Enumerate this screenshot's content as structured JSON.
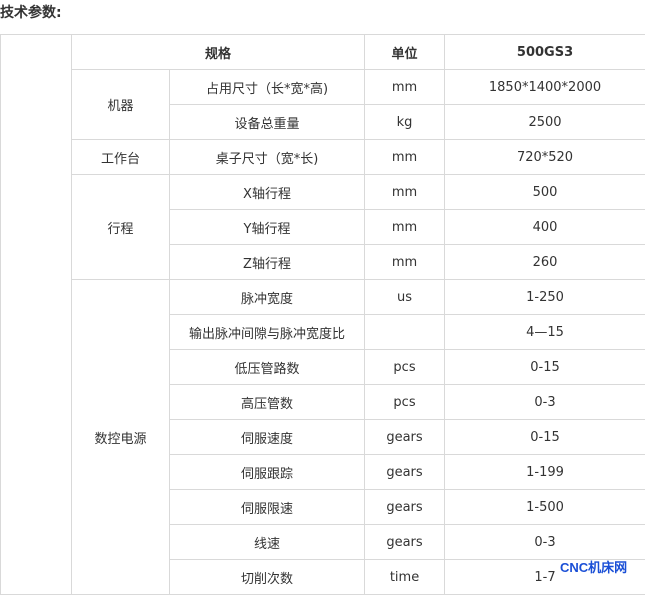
{
  "heading": "技术参数:",
  "columns": {
    "spec": "规格",
    "unit": "单位",
    "model": "500GS3"
  },
  "groups": {
    "machine": "机器",
    "worktable": "工作台",
    "travel": "行程",
    "power": "数控电源"
  },
  "rows": [
    {
      "name": "占用尺寸（长*宽*高)",
      "unit": "mm",
      "value": "1850*1400*2000"
    },
    {
      "name": "设备总重量",
      "unit": "kg",
      "value": "2500"
    },
    {
      "name": "桌子尺寸（宽*长)",
      "unit": "mm",
      "value": "720*520"
    },
    {
      "name": "X轴行程",
      "unit": "mm",
      "value": "500"
    },
    {
      "name": "Y轴行程",
      "unit": "mm",
      "value": "400"
    },
    {
      "name": "Z轴行程",
      "unit": "mm",
      "value": "260"
    },
    {
      "name": "脉冲宽度",
      "unit": "us",
      "value": "1-250"
    },
    {
      "name": "输出脉冲间隙与脉冲宽度比",
      "unit": "",
      "value": "4—15"
    },
    {
      "name": "低压管路数",
      "unit": "pcs",
      "value": "0-15"
    },
    {
      "name": "高压管数",
      "unit": "pcs",
      "value": "0-3"
    },
    {
      "name": "伺服速度",
      "unit": "gears",
      "value": "0-15"
    },
    {
      "name": "伺服跟踪",
      "unit": "gears",
      "value": "1-199"
    },
    {
      "name": "伺服限速",
      "unit": "gears",
      "value": "1-500"
    },
    {
      "name": "线速",
      "unit": "gears",
      "value": "0-3"
    },
    {
      "name": "切削次数",
      "unit": "time",
      "value": "1-7"
    }
  ],
  "watermark": "CNC机床网"
}
